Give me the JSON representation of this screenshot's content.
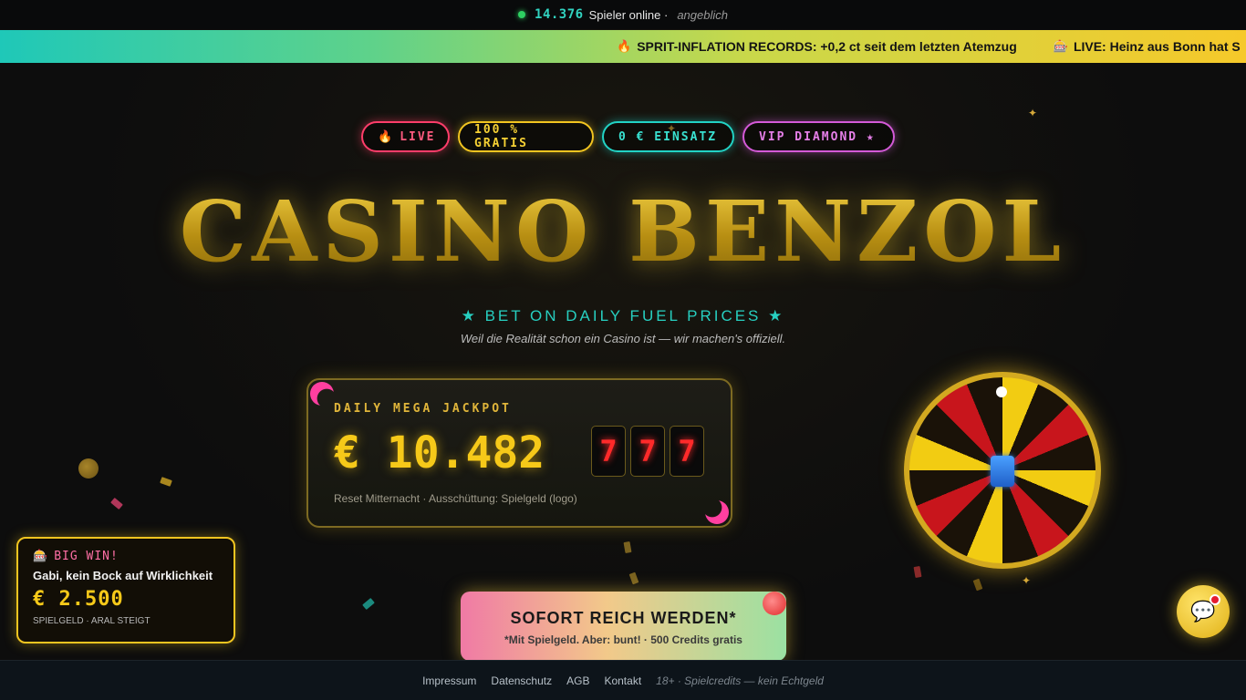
{
  "topbar": {
    "count": "14.376",
    "label": "Spieler online ·",
    "qualifier": "angeblich"
  },
  "ticker": {
    "items": [
      {
        "icon": "flame-icon",
        "text": "SPRIT-INFLATION RECORDS: +0,2 ct seit dem letzten Atemzug"
      },
      {
        "icon": "slot-machine-icon",
        "text": "LIVE: Heinz aus Bonn hat S"
      }
    ]
  },
  "badges": {
    "live": "LIVE",
    "gratis": "100 % GRATIS",
    "einsatz": "0 € EINSATZ",
    "vip": "VIP DIAMOND ★"
  },
  "hero": {
    "title": "CASINO BENZOL",
    "tagline": "★ BET ON DAILY FUEL PRICES ★",
    "subtagline": "Weil die Realität schon ein Casino ist — wir machen's offiziell."
  },
  "jackpot": {
    "label": "DAILY MEGA JACKPOT",
    "amount": "€ 10.482",
    "reels": [
      "7",
      "7",
      "7"
    ],
    "note": "Reset Mitternacht · Ausschüttung: Spielgeld (logo)"
  },
  "bigwin": {
    "label": "BIG WIN!",
    "name": "Gabi, kein Bock auf Wirklichkeit",
    "amount": "€ 2.500",
    "note": "SPIELGELD · ARAL STEIGT"
  },
  "cta": {
    "title": "SOFORT REICH WERDEN*",
    "subtitle": "*Mit Spielgeld. Aber: bunt! · 500 Credits gratis"
  },
  "footer": {
    "links": [
      "Impressum",
      "Datenschutz",
      "AGB",
      "Kontakt"
    ],
    "disclaimer": "18+ · Spielcredits — kein Echtgeld"
  },
  "colors": {
    "gold": "#f6c919",
    "teal": "#27cfc0",
    "pink": "#ff5a7f",
    "violet": "#e57fe8"
  }
}
